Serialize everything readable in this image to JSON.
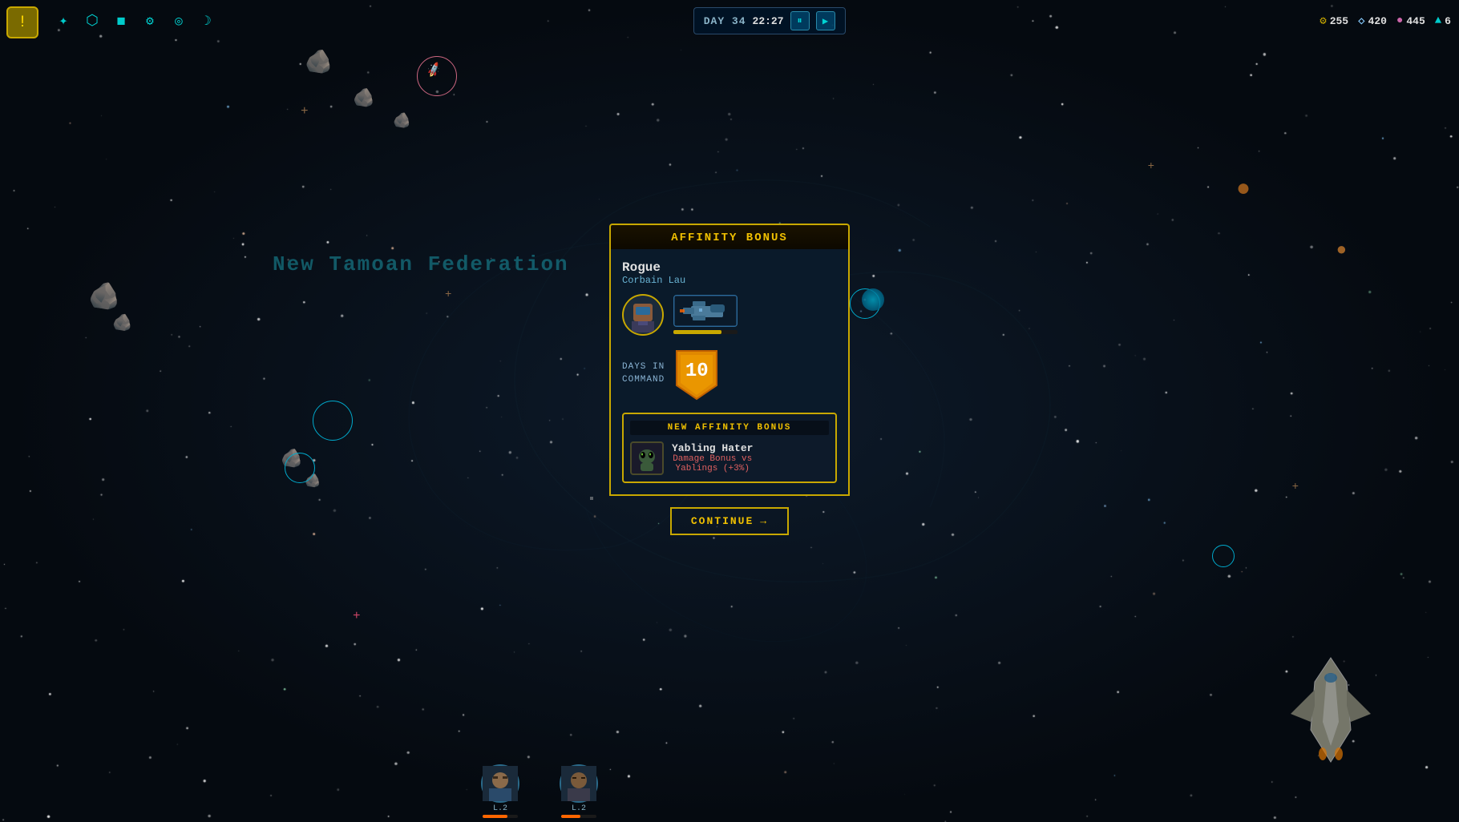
{
  "hud": {
    "day_label": "DAY 34",
    "time_label": "22:27",
    "pause_btn": "⏸",
    "fast_btn": "▶",
    "resources": {
      "material": {
        "icon": "⚙",
        "value": "255",
        "color": "#c8a800"
      },
      "crystal": {
        "icon": "◇",
        "value": "420",
        "color": "#88ccff"
      },
      "energy": {
        "icon": "●",
        "value": "445",
        "color": "#cc66aa"
      },
      "alert": {
        "icon": "⚡",
        "value": "6",
        "color": "#00cccc"
      }
    }
  },
  "alert_btn": "!",
  "modal": {
    "title": "AFFINITY BONUS",
    "character_name": "Rogue",
    "character_sub": "Corbain Lau",
    "days_in_command_label": "DAYS IN\nCOMMAND",
    "days_value": "10",
    "new_affinity_title": "NEW AFFINITY BONUS",
    "bonus": {
      "name": "Yabling Hater",
      "desc_line1": "Damage Bonus vs",
      "desc_line2": "Yablings (+3%)"
    },
    "continue_label": "CONTINUE",
    "continue_arrow": "→"
  },
  "faction_text": "New Tamoan Federation",
  "bottom_chars": [
    {
      "level": "L.2",
      "hp_pct": 70
    },
    {
      "level": "L.2",
      "hp_pct": 55
    }
  ],
  "nav_icons": [
    "✦",
    "●",
    "■",
    "⚙",
    "◉",
    "☾"
  ]
}
